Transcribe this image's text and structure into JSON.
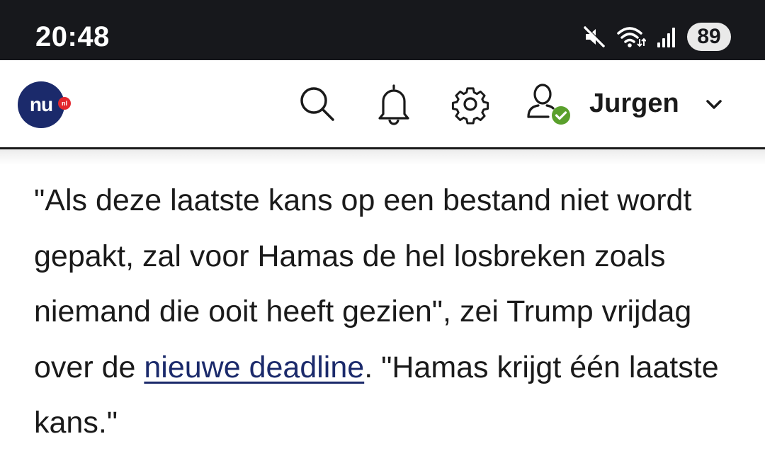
{
  "status_bar": {
    "time": "20:48",
    "battery": "89",
    "icons": [
      "mute-icon",
      "wifi-icon",
      "signal-icon"
    ]
  },
  "header": {
    "logo_text": "nu",
    "logo_badge": "nl",
    "icons": [
      "search-icon",
      "bell-icon",
      "gear-icon",
      "user-icon"
    ],
    "user_name": "Jurgen",
    "colors": {
      "brand": "#1b2a6b",
      "logo_dot": "#e3272e",
      "verified": "#5aa02c"
    }
  },
  "article": {
    "text_before_link": "\"Als deze laatste kans op een bestand niet wordt gepakt, zal voor Hamas de hel losbreken zoals niemand die ooit heeft gezien\", zei Trump vrijdag over de ",
    "link_text": "nieuwe deadline",
    "text_after_link": ". \"Hamas krijgt één laatste kans.\""
  }
}
